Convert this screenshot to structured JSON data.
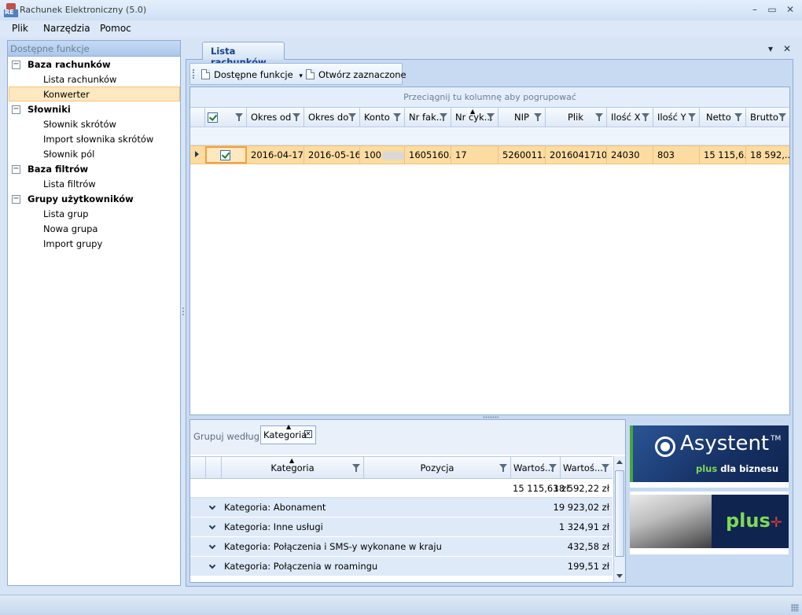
{
  "window": {
    "title": "Rachunek Elektroniczny (5.0)",
    "logo_text": "RE",
    "minimize_icon": "minimize-icon",
    "maximize_icon": "maximize-icon",
    "close_icon": "close-icon"
  },
  "menu": [
    "Plik",
    "Narzędzia",
    "Pomoc"
  ],
  "sidebar": {
    "header": "Dostępne funkcje",
    "groups": [
      {
        "label": "Baza rachunków",
        "expander": "⊟",
        "items": [
          "Lista rachunków",
          "Konwerter"
        ]
      },
      {
        "label": "Słowniki",
        "expander": "⊟",
        "items": [
          "Słownik skrótów",
          "Import słownika skrótów",
          "Słownik pól"
        ]
      },
      {
        "label": "Baza filtrów",
        "expander": "⊟",
        "items": [
          "Lista filtrów"
        ]
      },
      {
        "label": "Grupy użytkowników",
        "expander": "⊟",
        "items": [
          "Lista grup",
          "Nowa grupa",
          "Import grupy"
        ]
      }
    ],
    "selected_item": "Konwerter"
  },
  "document": {
    "tab_label": "Lista rachunków",
    "tab_menu_icon": "▾",
    "tab_close_icon": "✕"
  },
  "toolbar": {
    "functions_label": "Dostępne funkcje",
    "functions_arrow": "▾",
    "open_label": "Otwórz zaznaczone"
  },
  "main_grid": {
    "group_panel_text": "Przeciągnij tu kolumnę aby pogrupować",
    "columns": [
      "",
      "Okres od",
      "Okres do",
      "Konto",
      "Nr fak...",
      "Nr cyk...",
      "NIP",
      "Plik",
      "Ilość X",
      "Ilość Y",
      "Netto",
      "Brutto"
    ],
    "sorted_column": "Nr cyk...",
    "rows": [
      {
        "checked": true,
        "okres_od": "2016-04-17",
        "okres_do": "2016-05-16",
        "konto": "100",
        "nr_faktury": "1605160...",
        "nr_cyklu": "17",
        "nip": "5260011...",
        "plik": "2016041710...",
        "ilosc_x": "24030",
        "ilosc_y": "803",
        "netto": "15 115,6...",
        "brutto": "18 592,..."
      }
    ]
  },
  "bottom_grid": {
    "groupby_label": "Grupuj według:",
    "groupby_chip": "Kategoria",
    "columns": [
      "Kategoria",
      "Pozycja",
      "Wartoś...",
      "Wartoś..."
    ],
    "totals": [
      "15 115,63 zł",
      "18 592,22 zł"
    ],
    "groups": [
      {
        "label": "Kategoria: Abonament",
        "value": "19 923,02 zł"
      },
      {
        "label": "Kategoria: Inne usługi",
        "value": "1 324,91 zł"
      },
      {
        "label": "Kategoria: Połączenia i SMS-y wykonane w kraju",
        "value": "432,58 zł"
      },
      {
        "label": "Kategoria: Połączenia w roamingu",
        "value": "199,51 zł"
      }
    ]
  },
  "ads": {
    "asystent_title": "Asystent",
    "asystent_tm": "TM",
    "asystent_sub_plus": "plus",
    "asystent_sub_rest": " dla biznesu",
    "plus_logo": "plus",
    "plus_cross": "✛",
    "colors": {
      "brand_green": "#7ed957",
      "brand_navy": "#0f2550",
      "brand_red": "#e03c3c"
    }
  },
  "colors": {
    "selection_fill": "#fcdca1",
    "selection_border": "#f5c37a",
    "accent_blue": "#15428b",
    "panel_bg": "#c8daf2"
  }
}
